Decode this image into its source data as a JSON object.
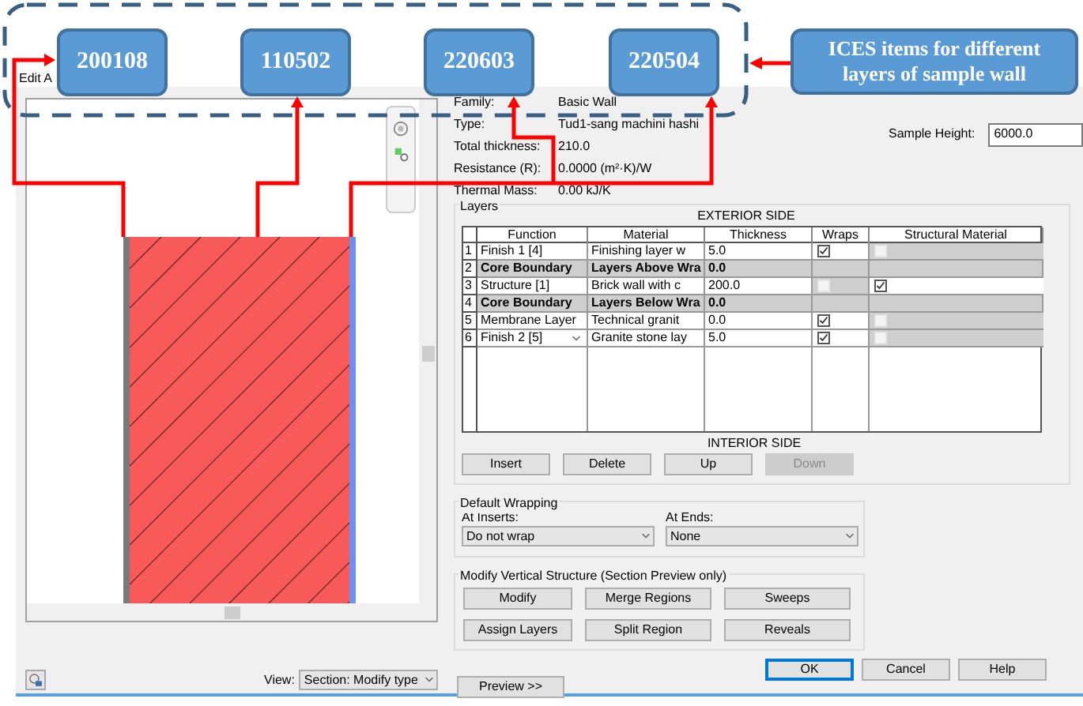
{
  "annotations": {
    "boxes": [
      {
        "label": "200108"
      },
      {
        "label": "110502"
      },
      {
        "label": "220603"
      },
      {
        "label": "220504"
      }
    ],
    "callout": {
      "label": "ICES items for different layers of sample wall"
    }
  },
  "window": {
    "title": "Edit A"
  },
  "properties": [
    {
      "label": "Family:",
      "value": "Basic Wall"
    },
    {
      "label": "Type:",
      "value": "Tud1-sang machini hashi"
    },
    {
      "label": "Total thickness:",
      "value": "210.0"
    },
    {
      "label": "Resistance (R):",
      "value": "0.0000 (m²·K)/W"
    },
    {
      "label": "Thermal Mass:",
      "value": "0.00 kJ/K"
    }
  ],
  "sample_height": {
    "label": "Sample Height:",
    "value": "6000.0"
  },
  "layers": {
    "title": "Layers",
    "exterior_label": "EXTERIOR SIDE",
    "interior_label": "INTERIOR SIDE",
    "columns": [
      "Function",
      "Material",
      "Thickness",
      "Wraps",
      "Structural Material"
    ],
    "rows": [
      {
        "kind": "layer",
        "number": "1",
        "function": "Finish 1 [4]",
        "material": "Finishing layer w",
        "thickness": "5.0",
        "dropdown": false,
        "wraps": {
          "checked": true,
          "disabled": false
        },
        "structural": {
          "checked": false,
          "disabled": true
        }
      },
      {
        "kind": "boundary",
        "number": "2",
        "function": "Core Boundary",
        "material": "Layers Above Wra",
        "thickness": "0.0"
      },
      {
        "kind": "layer",
        "number": "3",
        "function": "Structure [1]",
        "material": "Brick wall with c",
        "thickness": "200.0",
        "dropdown": false,
        "wraps": {
          "checked": false,
          "disabled": true
        },
        "structural": {
          "checked": true,
          "disabled": false
        }
      },
      {
        "kind": "boundary",
        "number": "4",
        "function": "Core Boundary",
        "material": "Layers Below Wra",
        "thickness": "0.0"
      },
      {
        "kind": "layer",
        "number": "5",
        "function": "Membrane Layer",
        "material": "Technical granit",
        "thickness": "0.0",
        "dropdown": false,
        "wraps": {
          "checked": true,
          "disabled": false
        },
        "structural": {
          "checked": false,
          "disabled": true
        }
      },
      {
        "kind": "layer",
        "number": "6",
        "function": "Finish 2 [5]",
        "material": "Granite stone lay",
        "thickness": "5.0",
        "dropdown": true,
        "wraps": {
          "checked": true,
          "disabled": false
        },
        "structural": {
          "checked": false,
          "disabled": true
        }
      }
    ],
    "buttons": [
      {
        "label": "Insert",
        "disabled": false
      },
      {
        "label": "Delete",
        "disabled": false
      },
      {
        "label": "Up",
        "disabled": false
      },
      {
        "label": "Down",
        "disabled": true
      }
    ]
  },
  "default_wrapping": {
    "title": "Default Wrapping",
    "at_inserts": {
      "label": "At Inserts:",
      "value": "Do not wrap"
    },
    "at_ends": {
      "label": "At Ends:",
      "value": "None"
    }
  },
  "vertical_structure": {
    "title": "Modify Vertical Structure (Section Preview only)",
    "buttons": [
      "Modify",
      "Merge Regions",
      "Sweeps",
      "Assign Layers",
      "Split Region",
      "Reveals"
    ]
  },
  "dialog_buttons": [
    {
      "label": "OK",
      "default": true
    },
    {
      "label": "Cancel",
      "default": false
    },
    {
      "label": "Help",
      "default": false
    }
  ],
  "view": {
    "label": "View:",
    "value": "Section: Modify type"
  },
  "preview_button": "Preview >>"
}
